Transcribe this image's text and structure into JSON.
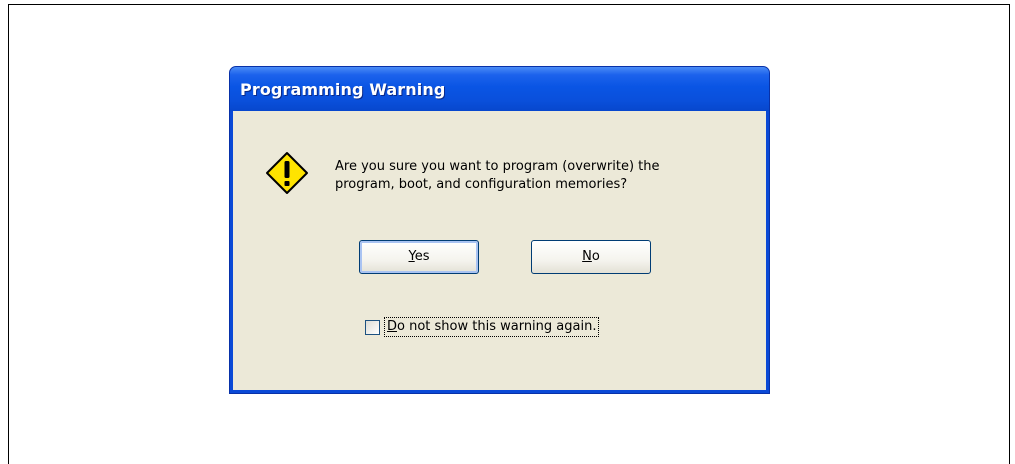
{
  "dialog": {
    "title": "Programming Warning",
    "icon": "warning-icon",
    "message_line1": "Are you sure you want to program (overwrite) the",
    "message_line2": "program, boot, and configuration memories?",
    "buttons": {
      "yes_first": "Y",
      "yes_rest": "es",
      "no_first": "N",
      "no_rest": "o"
    },
    "checkbox": {
      "label_first": "D",
      "label_rest": "o not show this warning again.",
      "checked": false
    }
  },
  "colors": {
    "titlebar": "#0a55e4",
    "client_background": "#ece9d8",
    "warning_yellow": "#ffe400"
  }
}
